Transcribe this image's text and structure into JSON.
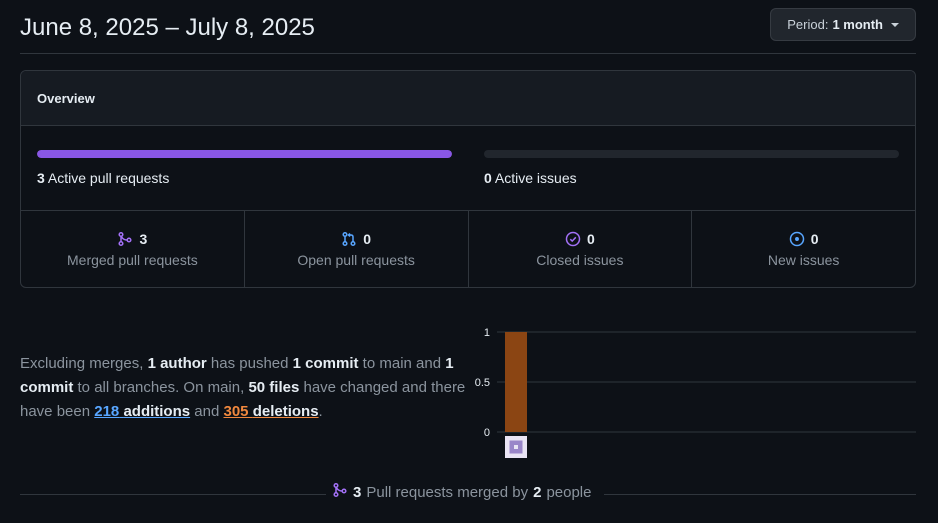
{
  "header": {
    "title": "June 8, 2025 – July 8, 2025",
    "period_prefix": "Period:",
    "period_value": "1 month"
  },
  "overview": {
    "title": "Overview",
    "pull_requests": {
      "count": "3",
      "label": "Active pull requests",
      "fill_fraction": 1.0,
      "color": "#8957e5"
    },
    "issues": {
      "count": "0",
      "label": "Active issues",
      "fill_fraction": 0.0,
      "color": "#238636"
    },
    "stats": [
      {
        "icon": "merge-icon",
        "count": "3",
        "label": "Merged pull requests",
        "color": "#a371f7"
      },
      {
        "icon": "pull-request-icon",
        "count": "0",
        "label": "Open pull requests",
        "color": "#58a6ff"
      },
      {
        "icon": "issue-closed-icon",
        "count": "0",
        "label": "Closed issues",
        "color": "#a371f7"
      },
      {
        "icon": "issue-opened-icon",
        "count": "0",
        "label": "New issues",
        "color": "#58a6ff"
      }
    ]
  },
  "summary": {
    "t1": "Excluding merges, ",
    "authors": "1 author",
    "t2": " has pushed ",
    "commits_main": "1 commit",
    "t3": " to main and ",
    "commits_all": "1 commit",
    "t4": " to all branches. On main, ",
    "files": "50 files",
    "t5": " have changed and there have been ",
    "additions_num": "218",
    "additions_word": "additions",
    "t6": " and ",
    "deletions_num": "305",
    "deletions_word": "deletions",
    "t7": "."
  },
  "chart_data": {
    "type": "bar",
    "categories": [
      "author-1"
    ],
    "values": [
      1
    ],
    "yticks": [
      "0",
      "0.5",
      "1"
    ],
    "ylim": [
      0,
      1
    ],
    "bar_color": "#8b4513",
    "grid": true
  },
  "footer": {
    "pr_count": "3",
    "t1": "Pull requests merged by",
    "people_count": "2",
    "t2": "people"
  }
}
